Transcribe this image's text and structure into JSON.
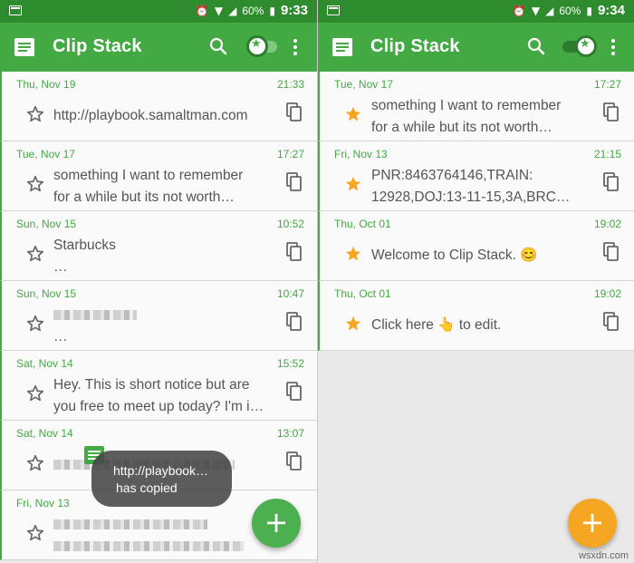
{
  "colors": {
    "primary": "#43a943",
    "status_bar": "#2e8b2e",
    "accent_orange": "#f5a623",
    "fab_green": "#4caf50"
  },
  "left_screen": {
    "status": {
      "battery": "60%",
      "time": "9:33"
    },
    "app_title": "Clip Stack",
    "clips": [
      {
        "date": "Thu, Nov 19",
        "time": "21:33",
        "line1": "http://playbook.samaltman.com",
        "line2": "",
        "starred": false
      },
      {
        "date": "Tue, Nov 17",
        "time": "17:27",
        "line1": "something I want to remember",
        "line2": "for a while but its not worth…",
        "starred": false
      },
      {
        "date": "Sun, Nov 15",
        "time": "10:52",
        "line1": "Starbucks",
        "line2": "…",
        "starred": false
      },
      {
        "date": "Sun, Nov 15",
        "time": "10:47",
        "line1": "",
        "line2": "…",
        "starred": false,
        "blurred": true
      },
      {
        "date": "Sat, Nov 14",
        "time": "15:52",
        "line1": "Hey. This is short notice but are",
        "line2": "you free to meet up today? I'm i…",
        "starred": false
      },
      {
        "date": "Sat, Nov 14",
        "time": "13:07",
        "line1": "",
        "line2": "",
        "starred": false,
        "blurred": true
      },
      {
        "date": "Fri, Nov 13",
        "time": "",
        "line1": "",
        "line2": "",
        "starred": false,
        "blurred": true
      }
    ],
    "toast": {
      "line1": "http://playbook…",
      "line2": "has copied"
    },
    "fab_label": "+"
  },
  "right_screen": {
    "status": {
      "battery": "60%",
      "time": "9:34"
    },
    "app_title": "Clip Stack",
    "clips": [
      {
        "date": "Tue, Nov 17",
        "time": "17:27",
        "line1": "something I want to remember",
        "line2": "for a while but its not worth…",
        "starred": true
      },
      {
        "date": "Fri, Nov 13",
        "time": "21:15",
        "line1": "PNR:8463764146,TRAIN:",
        "line2": "12928,DOJ:13-11-15,3A,BRC…",
        "starred": true
      },
      {
        "date": "Thu, Oct 01",
        "time": "19:02",
        "line1": "Welcome to Clip Stack. 😊",
        "line2": "",
        "starred": true
      },
      {
        "date": "Thu, Oct 01",
        "time": "19:02",
        "line1": "Click here 👆 to edit.",
        "line2": "",
        "starred": true
      }
    ],
    "fab_label": "+"
  },
  "watermark": "wsxdn.com"
}
